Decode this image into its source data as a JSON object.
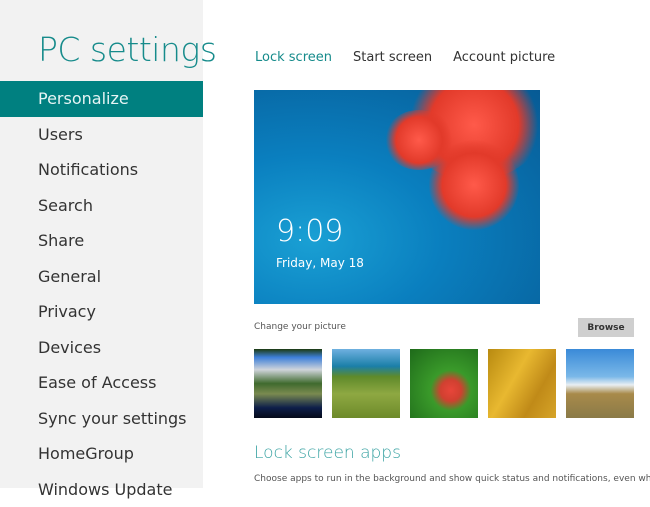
{
  "sidebar": {
    "title": "PC settings",
    "items": [
      {
        "label": "Personalize"
      },
      {
        "label": "Users"
      },
      {
        "label": "Notifications"
      },
      {
        "label": "Search"
      },
      {
        "label": "Share"
      },
      {
        "label": "General"
      },
      {
        "label": "Privacy"
      },
      {
        "label": "Devices"
      },
      {
        "label": "Ease of Access"
      },
      {
        "label": "Sync your settings"
      },
      {
        "label": "HomeGroup"
      },
      {
        "label": "Windows Update"
      }
    ],
    "active_index": 0
  },
  "tabs": [
    {
      "label": "Lock screen"
    },
    {
      "label": "Start screen"
    },
    {
      "label": "Account picture"
    }
  ],
  "lock_preview": {
    "time": "9:09",
    "date": "Friday, May 18"
  },
  "change_picture": {
    "label": "Change your picture",
    "browse_label": "Browse"
  },
  "lock_apps": {
    "heading": "Lock screen apps",
    "description": "Choose apps to run in the background and show quick status and notifications, even when"
  },
  "colors": {
    "accent": "#008080",
    "sidebar_bg": "#f2f2f2"
  }
}
